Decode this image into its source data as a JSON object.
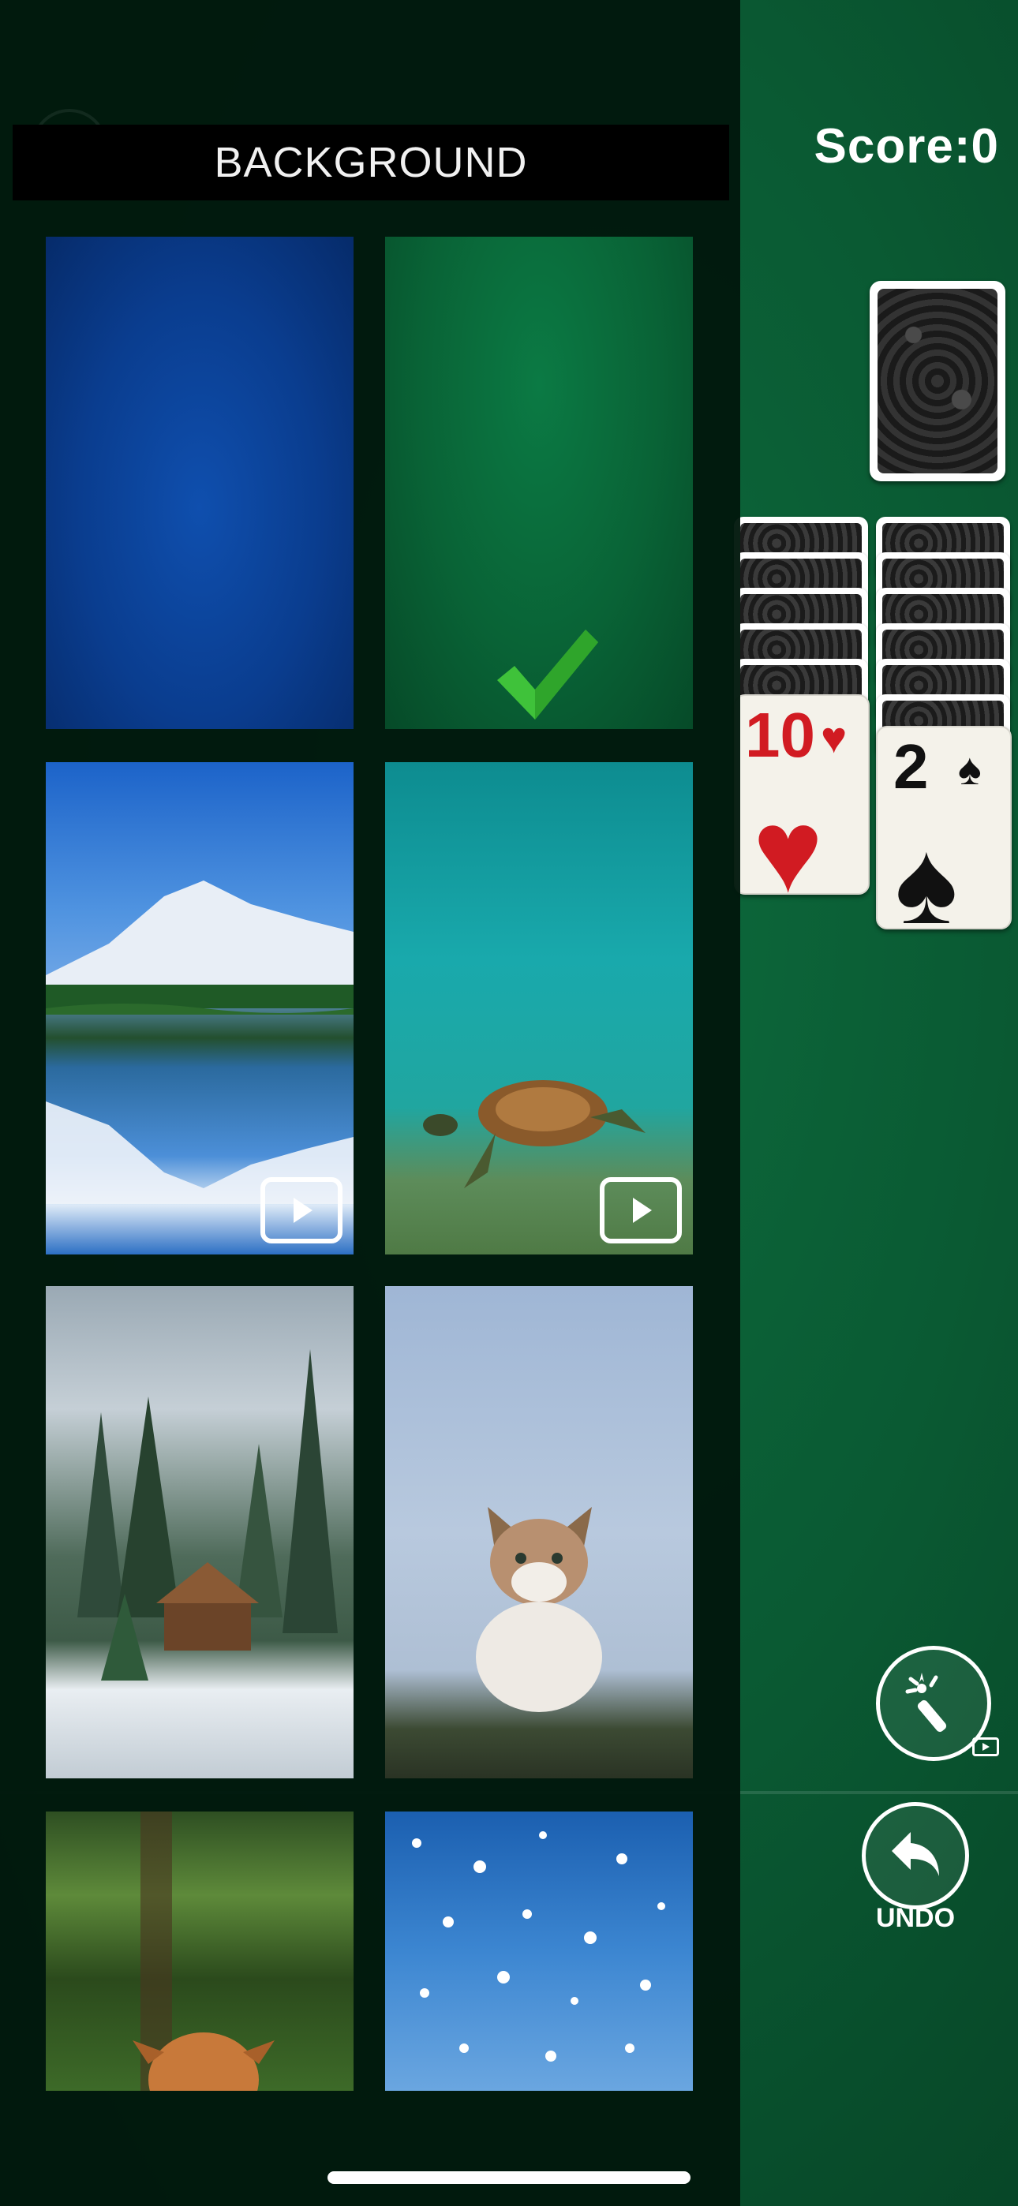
{
  "game": {
    "score_text": "Score:0",
    "undo_label": "UNDO",
    "tableau": [
      {
        "rank": "10",
        "suit": "♥",
        "color": "red"
      },
      {
        "rank": "2",
        "suit": "♠",
        "color": "black"
      }
    ]
  },
  "drawer": {
    "title": "BACKGROUND",
    "selected_index": 1,
    "tiles": [
      {
        "name": "blue",
        "locked_by_ad": false
      },
      {
        "name": "green",
        "locked_by_ad": false
      },
      {
        "name": "mountain-lake",
        "locked_by_ad": true
      },
      {
        "name": "sea-turtle",
        "locked_by_ad": true
      },
      {
        "name": "winter-cabin",
        "locked_by_ad": false
      },
      {
        "name": "cat",
        "locked_by_ad": false
      },
      {
        "name": "dog-forest",
        "locked_by_ad": false
      },
      {
        "name": "snowfall",
        "locked_by_ad": false
      }
    ]
  },
  "colors": {
    "table_green": "#0a5a33",
    "accent_check": "#3fc23a",
    "card_red": "#d11b22"
  }
}
